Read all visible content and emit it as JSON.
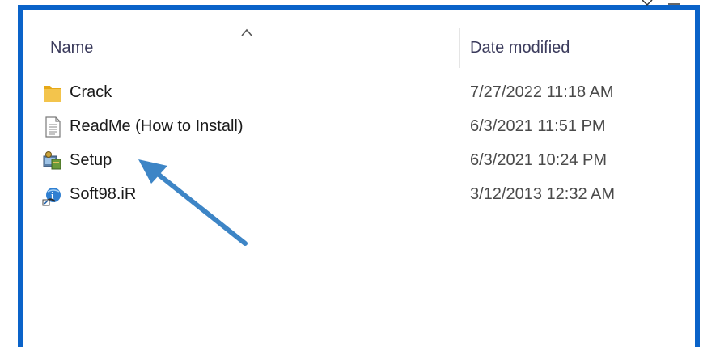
{
  "header": {
    "name_label": "Name",
    "date_label": "Date modified"
  },
  "files": [
    {
      "name": "Crack",
      "date": "7/27/2022 11:18 AM",
      "icon": "folder-icon"
    },
    {
      "name": "ReadMe (How to Install)",
      "date": "6/3/2021 11:51 PM",
      "icon": "text-file-icon"
    },
    {
      "name": "Setup",
      "date": "6/3/2021 10:24 PM",
      "icon": "setup-installer-icon"
    },
    {
      "name": "Soft98.iR",
      "date": "3/12/2013 12:32 AM",
      "icon": "internet-shortcut-icon"
    }
  ],
  "colors": {
    "border": "#0a63c9",
    "arrow": "#3d85c6",
    "folder": "#f3c44c"
  }
}
